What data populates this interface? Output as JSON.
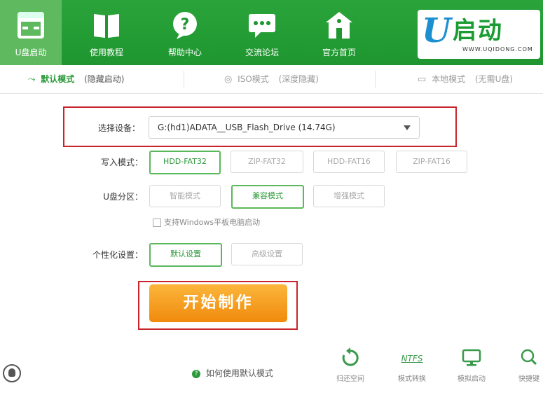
{
  "nav": {
    "items": [
      {
        "label": "U盘启动"
      },
      {
        "label": "使用教程"
      },
      {
        "label": "帮助中心"
      },
      {
        "label": "交流论坛"
      },
      {
        "label": "官方首页"
      }
    ]
  },
  "logo": {
    "u": "U",
    "text": "启动",
    "url": "WWW.UQIDONG.COM"
  },
  "modes": [
    {
      "label": "默认模式",
      "sub": "(隐藏启动)"
    },
    {
      "label": "ISO模式",
      "sub": "(深度隐藏)"
    },
    {
      "label": "本地模式",
      "sub": "(无需U盘)"
    }
  ],
  "form": {
    "device_label": "选择设备：",
    "device_value": "G:(hd1)ADATA__USB_Flash_Drive (14.74G)",
    "write_label": "写入模式：",
    "write_options": [
      "HDD-FAT32",
      "ZIP-FAT32",
      "HDD-FAT16",
      "ZIP-FAT16"
    ],
    "partition_label": "U盘分区：",
    "partition_options": [
      "智能模式",
      "兼容模式",
      "增强模式"
    ],
    "tablet_checkbox": "支持Windows平板电脑启动",
    "personal_label": "个性化设置：",
    "personal_options": [
      "默认设置",
      "高级设置"
    ],
    "start_button": "开始制作"
  },
  "bottom": {
    "help_link": "如何使用默认模式",
    "tools": [
      {
        "label": "归还空间",
        "icon": "restore-icon"
      },
      {
        "label": "模式转换",
        "icon": "ntfs-icon",
        "icon_text": "NTFS"
      },
      {
        "label": "模拟启动",
        "icon": "monitor-icon"
      },
      {
        "label": "快捷键",
        "icon": "search-icon"
      }
    ]
  },
  "colors": {
    "header_green": "#2aa43a",
    "accent_green": "#2c9a3a",
    "highlight_red": "#c9242b",
    "button_orange": "#f39a1e"
  }
}
